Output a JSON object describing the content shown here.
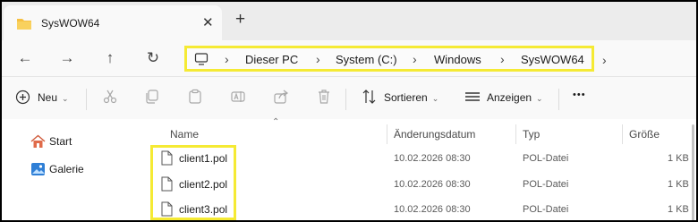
{
  "window": {
    "tab_title": "SysWOW64",
    "close_glyph": "✕",
    "new_tab_glyph": "+"
  },
  "nav": {
    "back_glyph": "←",
    "forward_glyph": "→",
    "up_glyph": "↑",
    "refresh_glyph": "↻",
    "chevron_glyph": "›",
    "breadcrumbs": [
      "Dieser PC",
      "System (C:)",
      "Windows",
      "SysWOW64"
    ]
  },
  "toolbar": {
    "new_label": "Neu",
    "sort_label": "Sortieren",
    "view_label": "Anzeigen",
    "more_glyph": "•••",
    "caret_glyph": "⌄"
  },
  "sidebar": {
    "items": [
      {
        "label": "Start",
        "icon": "home-icon"
      },
      {
        "label": "Galerie",
        "icon": "gallery-icon"
      }
    ]
  },
  "columns": {
    "name": "Name",
    "date": "Änderungsdatum",
    "type": "Typ",
    "size": "Größe",
    "sort_caret": "⌃"
  },
  "files": [
    {
      "name": "client1.pol",
      "date": "10.02.2026 08:30",
      "type": "POL-Datei",
      "size": "1 KB"
    },
    {
      "name": "client2.pol",
      "date": "10.02.2026 08:30",
      "type": "POL-Datei",
      "size": "1 KB"
    },
    {
      "name": "client3.pol",
      "date": "10.02.2026 08:30",
      "type": "POL-Datei",
      "size": "1 KB"
    }
  ],
  "colors": {
    "highlight": "#f5ea34",
    "folder": "#f6c042"
  }
}
